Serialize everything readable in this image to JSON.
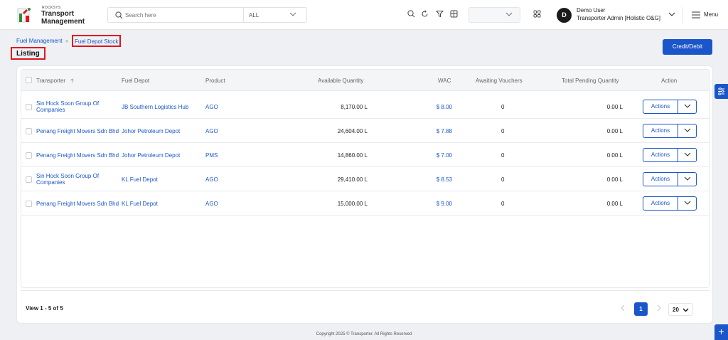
{
  "app": {
    "logo_small": "ROCKSYS",
    "logo_line1": "Transport",
    "logo_line2": "Management"
  },
  "search": {
    "placeholder": "Search here",
    "scope": "ALL"
  },
  "user": {
    "avatar_letter": "D",
    "name": "Demo User",
    "role": "Transporter Admin [Holistic O&G]"
  },
  "menu_label": "Menu",
  "breadcrumb": {
    "parent": "Fuel Management",
    "current": "Fuel Depot Stock"
  },
  "page": {
    "title": "Listing",
    "credit_button": "Credit/Debit"
  },
  "table": {
    "headers": {
      "transporter": "Transporter",
      "depot": "Fuel Depot",
      "product": "Product",
      "qty": "Available Quantity",
      "wac": "WAC",
      "vouchers": "Awaiting Vouchers",
      "pending": "Total Pending Quantity",
      "action": "Action"
    },
    "rows": [
      {
        "t1": "Sin Hock Soon Group Of",
        "t2": "Companies",
        "depot": "JB Southern Logistics Hub",
        "product": "AGO",
        "qty": "8,170.00 L",
        "wac": "$ 8.00",
        "vouchers": "0",
        "pending": "0.00 L",
        "action": "Actions"
      },
      {
        "t1": "Penang Freight Movers Sdn Bhd",
        "t2": "",
        "depot": "Johor Petroleum Depot",
        "product": "AGO",
        "qty": "24,604.00 L",
        "wac": "$ 7.88",
        "vouchers": "0",
        "pending": "0.00 L",
        "action": "Actions"
      },
      {
        "t1": "Penang Freight Movers Sdn Bhd",
        "t2": "",
        "depot": "Johor Petroleum Depot",
        "product": "PMS",
        "qty": "14,860.00 L",
        "wac": "$ 7.00",
        "vouchers": "0",
        "pending": "0.00 L",
        "action": "Actions"
      },
      {
        "t1": "Sin Hock Soon Group Of",
        "t2": "Companies",
        "depot": "KL Fuel Depot",
        "product": "AGO",
        "qty": "29,410.00 L",
        "wac": "$ 8.53",
        "vouchers": "0",
        "pending": "0.00 L",
        "action": "Actions"
      },
      {
        "t1": "Penang Freight Movers Sdn Bhd",
        "t2": "",
        "depot": "KL Fuel Depot",
        "product": "AGO",
        "qty": "15,000.00 L",
        "wac": "$ 9.00",
        "vouchers": "0",
        "pending": "0.00 L",
        "action": "Actions"
      }
    ]
  },
  "pagination": {
    "summary": "View 1 - 5 of 5",
    "current_page": "1",
    "page_size": "20"
  },
  "footer": {
    "copyright": "Copyright 2025 © Transporter. All Rights Reserved"
  },
  "colors": {
    "accent": "#1a56c9",
    "highlight": "#e0141e"
  }
}
